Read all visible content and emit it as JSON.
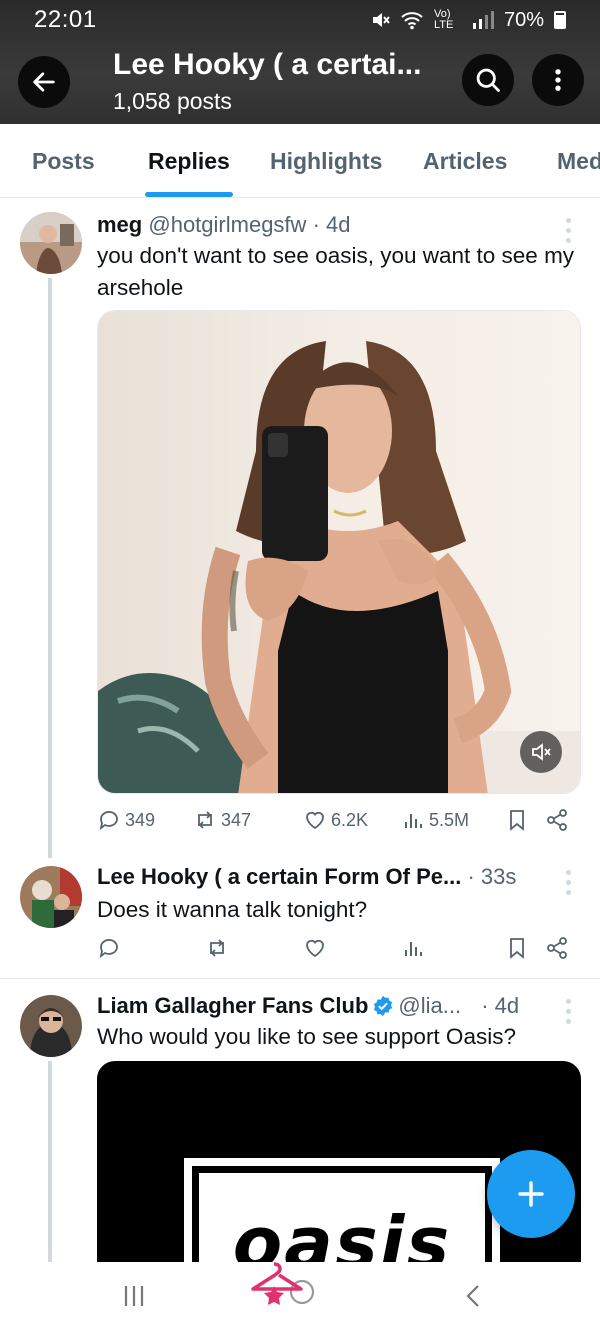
{
  "status": {
    "time": "22:01",
    "network": "Vo) LTE",
    "battery": "70%"
  },
  "profile": {
    "name": "Lee Hooky ( a certai...",
    "posts": "1,058 posts"
  },
  "tabs": [
    "Posts",
    "Replies",
    "Highlights",
    "Articles",
    "Med"
  ],
  "active_tab": "Replies",
  "tweets": [
    {
      "display_name": "meg",
      "handle": "@hotgirlmegsfw",
      "time": "· 4d",
      "text": "you don't want to see oasis, you want to see my arsehole",
      "stats": {
        "replies": "349",
        "reposts": "347",
        "likes": "6.2K",
        "views": "5.5M"
      },
      "media_kind": "video"
    },
    {
      "display_name": "Lee Hooky ( a certain Form Of Pe...",
      "handle": "",
      "time": "· 33s",
      "text": "Does it wanna talk tonight?"
    },
    {
      "display_name": "Liam Gallagher Fans Club",
      "handle": "@lia...",
      "time": "· 4d",
      "text": "Who would you like to see support Oasis?",
      "media_text": "oasis"
    }
  ],
  "icons": {
    "back": "arrow-left-icon",
    "search": "search-icon",
    "more": "more-vertical-icon",
    "reply": "reply-icon",
    "repost": "repost-icon",
    "like": "heart-icon",
    "views": "views-icon",
    "bookmark": "bookmark-icon",
    "share": "share-icon",
    "compose": "plus-icon",
    "mute": "mute-icon"
  },
  "colors": {
    "accent": "#1d9bf0",
    "muted": "#536471",
    "text": "#0f1419"
  }
}
